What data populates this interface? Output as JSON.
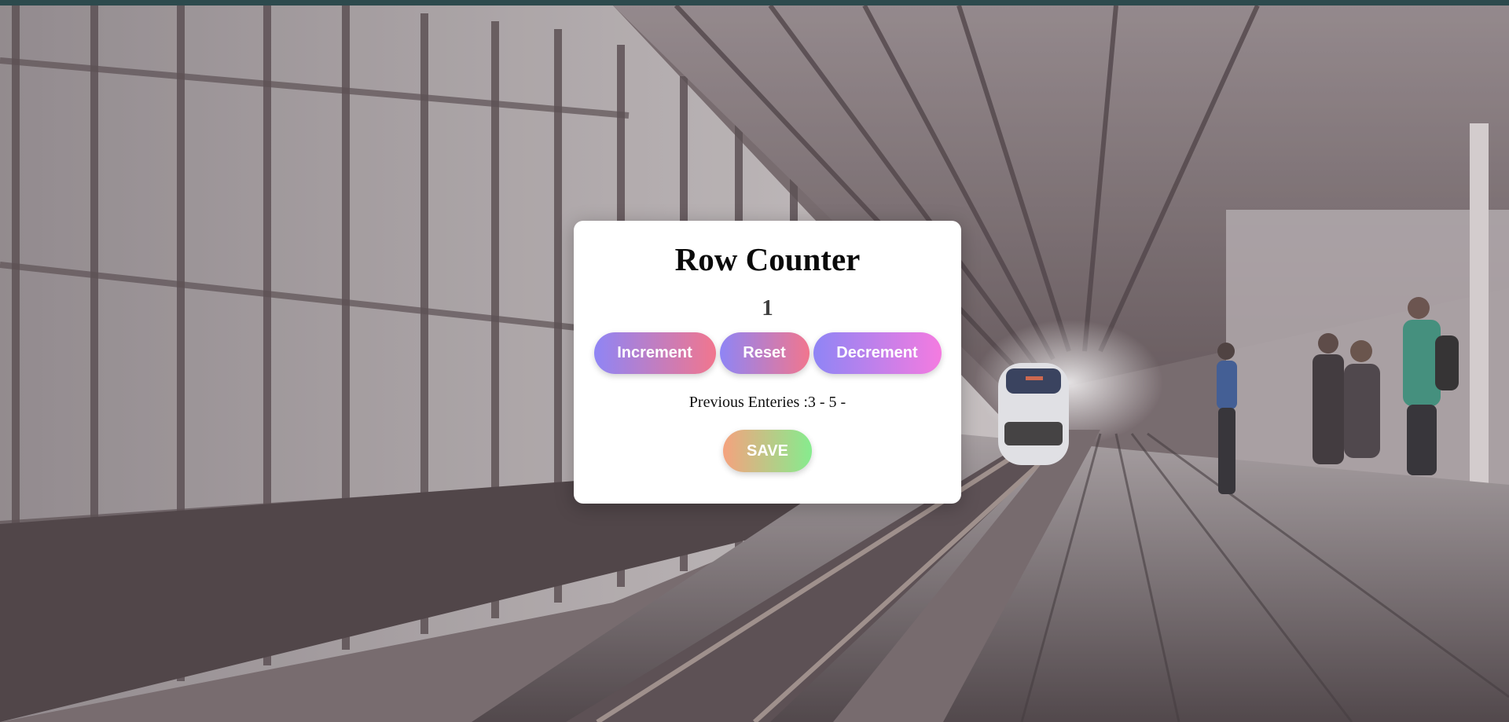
{
  "app": {
    "title": "Row Counter",
    "count": "1"
  },
  "buttons": {
    "increment": "Increment",
    "reset": "Reset",
    "decrement": "Decrement",
    "save": "SAVE"
  },
  "entries": {
    "text": "Previous Enteries :3 - 5 -"
  },
  "colors": {
    "top_strip": "#2d4a4d",
    "card_background": "#ffffff",
    "button_gradient_start": "#8f85f5",
    "button_gradient_end": "#f1768e",
    "decrement_gradient_end": "#f47be0",
    "save_gradient_start": "#f5a27e",
    "save_gradient_end": "#86ec8e"
  },
  "background": {
    "icon": "train-station-photo"
  }
}
